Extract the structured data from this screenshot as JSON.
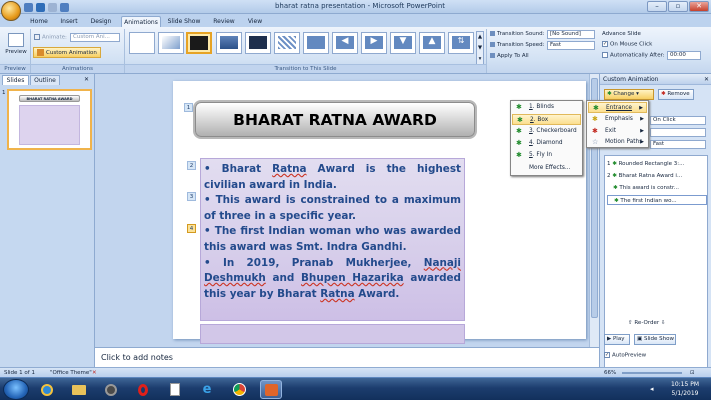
{
  "window": {
    "title": "bharat ratna presentation - Microsoft PowerPoint"
  },
  "tabs": [
    "Home",
    "Insert",
    "Design",
    "Animations",
    "Slide Show",
    "Review",
    "View"
  ],
  "active_tab": "Animations",
  "ribbon": {
    "preview_label": "Preview",
    "animate_label": "Animate:",
    "animate_value": "Custom Ani...",
    "custom_animation_label": "Custom Animation",
    "group_preview": "Preview",
    "group_animations": "Animations",
    "group_transition": "Transition to This Slide",
    "transition_sound_label": "Transition Sound:",
    "transition_sound_value": "[No Sound]",
    "transition_speed_label": "Transition Speed:",
    "transition_speed_value": "Fast",
    "apply_all_label": "Apply To All",
    "advance_label": "Advance Slide",
    "on_mouse_click_label": "On Mouse Click",
    "auto_after_label": "Automatically After:",
    "auto_after_value": "00:00"
  },
  "left_panel": {
    "tab_slides": "Slides",
    "tab_outline": "Outline",
    "slide_number": "1",
    "thumb_title": "BHARAT RATNA AWARD"
  },
  "slide": {
    "title": "BHARAT RATNA AWARD",
    "tag1": "1",
    "tag2": "2",
    "tag3": "3",
    "tag4": "4",
    "b1_pre": "• Bharat ",
    "b1_ul": "Ratna",
    "b1_post": " Award is the highest civilian award in India.",
    "b2": "• This award  is constrained to a maximum of three in a specific year.",
    "b3": "• The first Indian woman who was awarded this award was Smt. Indra Gandhi.",
    "b4_pre": "• In 2019, Pranab Mukherjee, ",
    "b4_ul1": "Nanaji Deshmukh",
    "b4_mid": " and ",
    "b4_ul2": "Bhupen Hazarika",
    "b4_mid2": " awarded this year by Bharat ",
    "b4_ul3": "Ratna",
    "b4_post": " Award."
  },
  "notes_placeholder": "Click to add notes",
  "custom_animation": {
    "title": "Custom Animation",
    "change_label": "Change",
    "remove_label": "Remove",
    "start_value": "On Click",
    "direction_value": "",
    "speed_value": "Fast",
    "items": [
      {
        "num": "1",
        "text": "Rounded Rectangle 3:..."
      },
      {
        "num": "2",
        "text": "Bharat Ratna Award i..."
      },
      {
        "num": "",
        "text": "This award  is constr..."
      },
      {
        "num": "",
        "text": "The first Indian wo..."
      }
    ],
    "reorder_label": "Re-Order",
    "play_label": "Play",
    "slideshow_label": "Slide Show",
    "autopreview_label": "AutoPreview"
  },
  "entrance_menu": [
    {
      "key": "1",
      "label": "Blinds"
    },
    {
      "key": "2",
      "label": "Box"
    },
    {
      "key": "3",
      "label": "Checkerboard"
    },
    {
      "key": "4",
      "label": "Diamond"
    },
    {
      "key": "5",
      "label": "Fly In"
    },
    {
      "key": "",
      "label": "More Effects..."
    }
  ],
  "change_menu": [
    {
      "label": "Entrance"
    },
    {
      "label": "Emphasis"
    },
    {
      "label": "Exit"
    },
    {
      "label": "Motion Paths"
    }
  ],
  "status": {
    "slide_info": "Slide 1 of 1",
    "theme": "\"Office Theme\"",
    "zoom": "66%"
  },
  "taskbar": {
    "time": "10:15 PM",
    "date": "5/1/2019"
  },
  "colors": {
    "accent": "#f7cf63",
    "entrance_star": "#1e8a2a",
    "emphasis_star": "#c9a514",
    "exit_star": "#c2281f"
  }
}
